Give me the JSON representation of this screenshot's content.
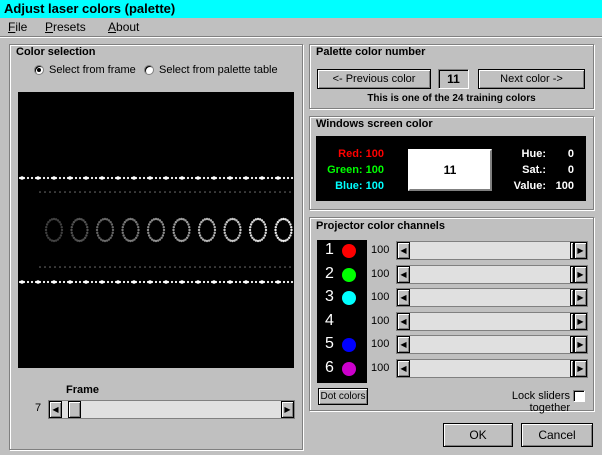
{
  "window": {
    "title": "Adjust laser colors (palette)"
  },
  "menu": [
    "File",
    "Presets",
    "About"
  ],
  "color_selection": {
    "title": "Color selection",
    "radio_frame": "Select from frame",
    "radio_palette": "Select from palette table",
    "frame_label": "Frame",
    "frame_value": "7",
    "frame_slider_fraction": 0.03
  },
  "palette": {
    "title": "Palette color number",
    "prev_label": "<- Previous color",
    "number": "11",
    "next_label": "Next color ->",
    "info": "This is one of the 24 training colors"
  },
  "screen_color": {
    "title": "Windows screen color",
    "red": "Red: 100",
    "green": "Green: 100",
    "blue": "Blue: 100",
    "swatch_text": "11",
    "hue_label": "Hue:",
    "hue_value": "0",
    "sat_label": "Sat.:",
    "sat_value": "0",
    "value_label": "Value:",
    "value_value": "100",
    "colors": {
      "red": "#ff0000",
      "green": "#00ff00",
      "blue": "#00ffff"
    }
  },
  "projector": {
    "title": "Projector color channels",
    "channels": [
      {
        "num": "1",
        "color": "#ff0000",
        "value": "100"
      },
      {
        "num": "2",
        "color": "#00ff00",
        "value": "100"
      },
      {
        "num": "3",
        "color": "#00ffff",
        "value": "100"
      },
      {
        "num": "4",
        "color": "",
        "value": "100"
      },
      {
        "num": "5",
        "color": "#0000ff",
        "value": "100"
      },
      {
        "num": "6",
        "color": "#cc00cc",
        "value": "100"
      }
    ],
    "dot_colors_label": "Dot colors",
    "lock_label": "Lock sliders together"
  },
  "buttons": {
    "ok": "OK",
    "cancel": "Cancel"
  }
}
